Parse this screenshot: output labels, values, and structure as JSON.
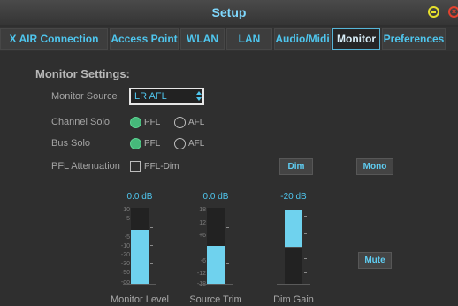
{
  "window": {
    "title": "Setup"
  },
  "tabs": [
    {
      "label": "X AIR Connection",
      "active": false
    },
    {
      "label": "Access Point",
      "active": false
    },
    {
      "label": "WLAN",
      "active": false
    },
    {
      "label": "LAN",
      "active": false
    },
    {
      "label": "Audio/Midi",
      "active": false
    },
    {
      "label": "Monitor",
      "active": true
    },
    {
      "label": "Preferences",
      "active": false
    }
  ],
  "monitor": {
    "heading": "Monitor Settings:",
    "source_label": "Monitor Source",
    "source_value": "LR AFL",
    "channel_solo": {
      "label": "Channel Solo",
      "options": [
        "PFL",
        "AFL"
      ],
      "selected": "PFL"
    },
    "bus_solo": {
      "label": "Bus Solo",
      "options": [
        "PFL",
        "AFL"
      ],
      "selected": "PFL"
    },
    "pfl_attenuation": {
      "label": "PFL Attenuation",
      "checkbox_label": "PFL-Dim",
      "checked": false
    },
    "buttons": {
      "dim": "Dim",
      "mono": "Mono",
      "mute": "Mute"
    },
    "faders": [
      {
        "label": "Monitor Level",
        "value": "0.0 dB",
        "fill_fraction": 0.71,
        "ticks": [
          "10",
          "5",
          "",
          "-5",
          "-10",
          "-20",
          "-30",
          "-50",
          "-oo"
        ]
      },
      {
        "label": "Source Trim",
        "value": "0.0 dB",
        "fill_fraction": 0.5,
        "ticks": [
          "18",
          "12",
          "+6",
          "",
          "-6",
          "-12",
          "-18"
        ]
      },
      {
        "label": "Dim Gain",
        "value": "-20 dB",
        "fill_fraction": 0.5,
        "fill_from_top": true,
        "ticks": []
      }
    ]
  },
  "colors": {
    "accent": "#4fc6ee",
    "fader_fill": "#6fd2ee",
    "radio_on": "#46b87a",
    "minimize": "#e6e02c",
    "close": "#e2402e"
  }
}
